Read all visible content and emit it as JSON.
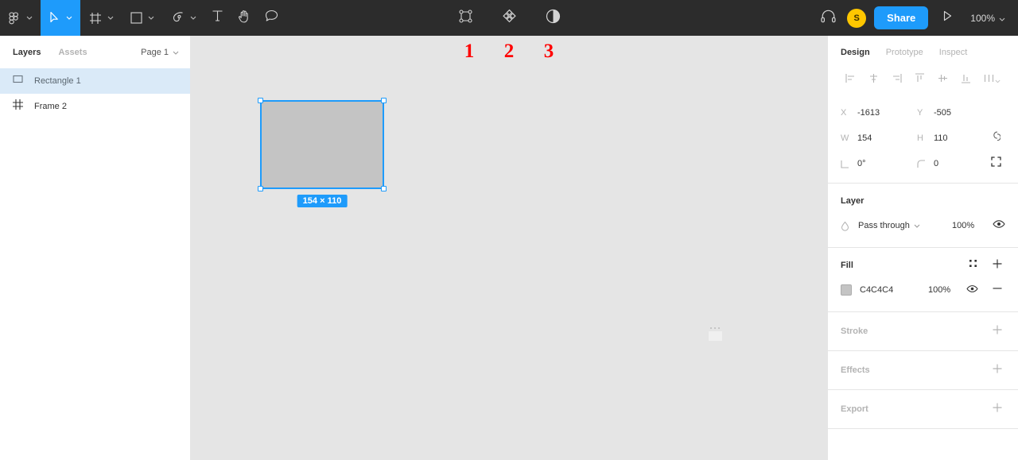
{
  "toolbar": {
    "logo_icon": "figma-logo-icon",
    "tools": [
      {
        "name": "move-tool",
        "icon": "cursor-icon",
        "active": true,
        "has_caret": true
      },
      {
        "name": "frame-tool",
        "icon": "frame-icon",
        "active": false,
        "has_caret": true
      },
      {
        "name": "shape-tool",
        "icon": "square-icon",
        "active": false,
        "has_caret": true
      },
      {
        "name": "pen-tool",
        "icon": "pen-icon",
        "active": false,
        "has_caret": true
      },
      {
        "name": "text-tool",
        "icon": "text-icon",
        "active": false,
        "has_caret": false
      },
      {
        "name": "hand-tool",
        "icon": "hand-icon",
        "active": false,
        "has_caret": false
      },
      {
        "name": "comment-tool",
        "icon": "comment-icon",
        "active": false,
        "has_caret": false
      }
    ],
    "center_tools": [
      {
        "name": "selection-points-button",
        "icon": "vector-points-icon"
      },
      {
        "name": "component-button",
        "icon": "component-diamond-icon"
      },
      {
        "name": "mask-button",
        "icon": "contrast-circle-icon"
      }
    ],
    "headphones_icon": "headphones-icon",
    "avatar_initial": "S",
    "share_label": "Share",
    "present_icon": "play-triangle-icon",
    "zoom_level": "100%"
  },
  "sidebar": {
    "tabs": [
      {
        "label": "Layers",
        "active": true
      },
      {
        "label": "Assets",
        "active": false
      }
    ],
    "page_selector": "Page 1",
    "layers": [
      {
        "name": "Rectangle 1",
        "icon": "rectangle-icon",
        "selected": true
      },
      {
        "name": "Frame 2",
        "icon": "frame-hash-icon",
        "selected": false
      }
    ]
  },
  "canvas": {
    "background_color": "#E5E5E5",
    "annotations": [
      "1",
      "2",
      "3"
    ],
    "annotation_color": "#FF0000",
    "selection": {
      "size_badge": "154 × 110",
      "fill_color": "#C4C4C4",
      "selection_color": "#1E9BFB"
    }
  },
  "right_panel": {
    "tabs": [
      {
        "label": "Design",
        "active": true
      },
      {
        "label": "Prototype",
        "active": false
      },
      {
        "label": "Inspect",
        "active": false
      }
    ],
    "align_buttons": [
      {
        "name": "align-left-button",
        "icon": "align-left-icon"
      },
      {
        "name": "align-horizontal-center-button",
        "icon": "align-horizontal-center-icon"
      },
      {
        "name": "align-right-button",
        "icon": "align-right-icon"
      },
      {
        "name": "align-top-button",
        "icon": "align-top-icon"
      },
      {
        "name": "align-vertical-center-button",
        "icon": "align-vertical-center-icon"
      },
      {
        "name": "align-bottom-button",
        "icon": "align-bottom-icon"
      },
      {
        "name": "distribute-button",
        "icon": "distribute-icon"
      }
    ],
    "properties": {
      "x_label": "X",
      "x_value": "-1613",
      "y_label": "Y",
      "y_value": "-505",
      "w_label": "W",
      "w_value": "154",
      "h_label": "H",
      "h_value": "110",
      "rotation_value": "0°",
      "corner_radius_value": "0",
      "constrain_icon": "link-proportions-icon",
      "constraints_icon": "constraints-expand-icon"
    },
    "layer_section": {
      "title": "Layer",
      "blend_mode": "Pass through",
      "opacity": "100%",
      "visibility_icon": "eye-icon",
      "blend_icon": "blend-drop-icon"
    },
    "fill_section": {
      "title": "Fill",
      "styles_icon": "four-dots-icon",
      "add_icon": "plus-icon",
      "color_hex": "C4C4C4",
      "opacity": "100%",
      "visibility_icon": "eye-icon",
      "remove_icon": "minus-icon"
    },
    "empty_sections": [
      {
        "title": "Stroke",
        "add_icon": "plus-icon"
      },
      {
        "title": "Effects",
        "add_icon": "plus-icon"
      },
      {
        "title": "Export",
        "add_icon": "plus-icon"
      }
    ]
  }
}
